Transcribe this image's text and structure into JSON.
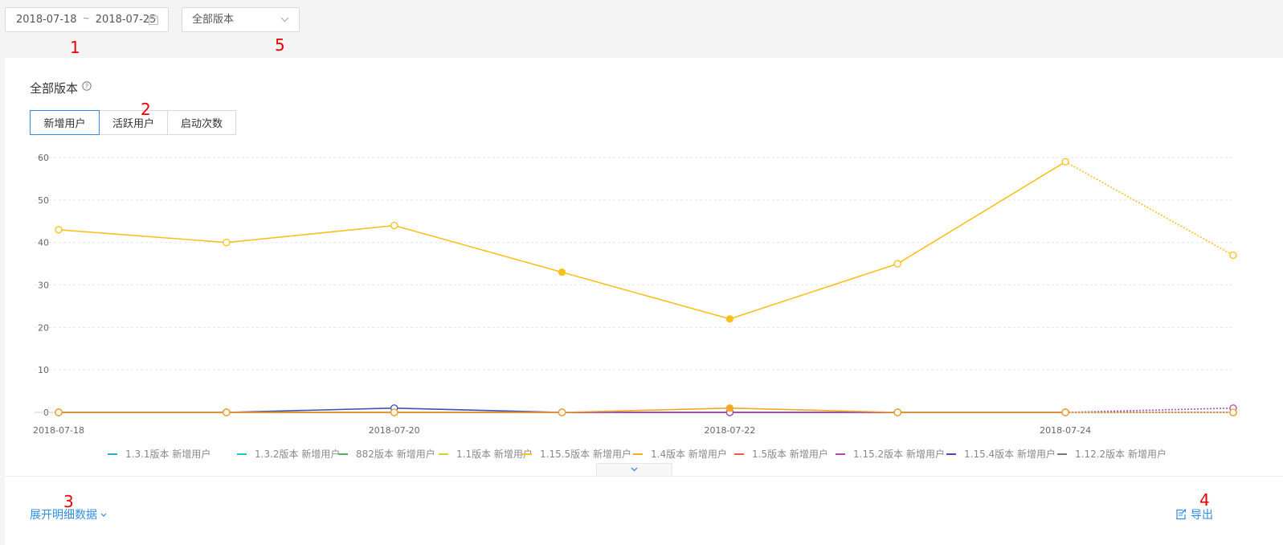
{
  "filters": {
    "date_start": "2018-07-18",
    "date_sep": "~",
    "date_end": "2018-07-25",
    "version_selected": "全部版本"
  },
  "annotations": {
    "a1": "1",
    "a2": "2",
    "a3": "3",
    "a4": "4",
    "a5": "5"
  },
  "panel": {
    "title": "全部版本",
    "tabs": [
      {
        "label": "新增用户",
        "active": true
      },
      {
        "label": "活跃用户",
        "active": false
      },
      {
        "label": "启动次数",
        "active": false
      }
    ],
    "expand_label": "展开明细数据",
    "export_label": "导出"
  },
  "chart_data": {
    "type": "line",
    "x": [
      "2018-07-18",
      "2018-07-19",
      "2018-07-20",
      "2018-07-21",
      "2018-07-22",
      "2018-07-23",
      "2018-07-24",
      "2018-07-25"
    ],
    "x_tick_labels": [
      "2018-07-18",
      "2018-07-20",
      "2018-07-22",
      "2018-07-24"
    ],
    "ylim": [
      0,
      60
    ],
    "y_ticks": [
      0,
      10,
      20,
      30,
      40,
      50,
      60
    ],
    "grid": true,
    "legend_placement": "bottom",
    "dotted_last_segment": true,
    "series": [
      {
        "name": "1.3.1版本 新增用户",
        "color": "#2fa7e0",
        "values": [
          0,
          0,
          0,
          0,
          0,
          0,
          0,
          0
        ]
      },
      {
        "name": "1.3.2版本 新增用户",
        "color": "#23c3c9",
        "values": [
          0,
          0,
          0,
          0,
          0,
          0,
          0,
          0
        ]
      },
      {
        "name": "882版本 新增用户",
        "color": "#53b257",
        "values": [
          0,
          0,
          0,
          0,
          0,
          0,
          0,
          0
        ]
      },
      {
        "name": "1.1版本 新增用户",
        "color": "#d4d82c",
        "values": [
          0,
          0,
          0,
          0,
          0,
          0,
          0,
          0
        ]
      },
      {
        "name": "1.15.5版本 新增用户",
        "color": "#fbc01c",
        "values": [
          43,
          40,
          44,
          33,
          22,
          35,
          59,
          37
        ]
      },
      {
        "name": "1.4版本 新增用户",
        "color": "#f5a623",
        "values": [
          0,
          0,
          0,
          0,
          1,
          0,
          0,
          0
        ]
      },
      {
        "name": "1.5版本 新增用户",
        "color": "#ee5a48",
        "values": [
          0,
          0,
          0,
          0,
          0,
          0,
          0,
          0
        ]
      },
      {
        "name": "1.15.2版本 新增用户",
        "color": "#b049b6",
        "values": [
          0,
          0,
          0,
          0,
          0,
          0,
          0,
          1
        ]
      },
      {
        "name": "1.15.4版本 新增用户",
        "color": "#3f51b5",
        "values": [
          0,
          0,
          1,
          0,
          0,
          0,
          0,
          0
        ]
      },
      {
        "name": "1.12.2版本 新增用户",
        "color": "#6b7a8f",
        "values": [
          0,
          0,
          0,
          0,
          0,
          0,
          0,
          0
        ]
      }
    ]
  }
}
